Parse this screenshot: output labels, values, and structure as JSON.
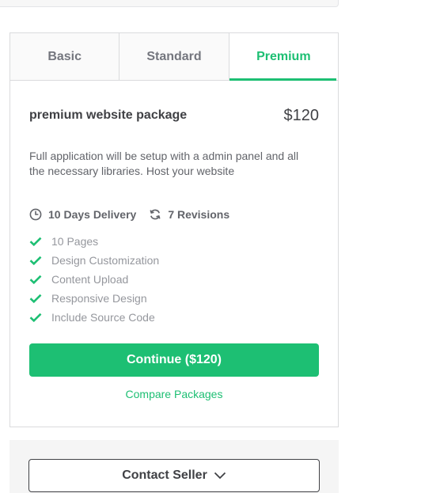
{
  "tabs": [
    {
      "label": "Basic",
      "active": false
    },
    {
      "label": "Standard",
      "active": false
    },
    {
      "label": "Premium",
      "active": true
    }
  ],
  "package": {
    "title": "premium website package",
    "price": "$120",
    "description": "Full application will be setup with a admin panel and all the necessary libraries. Host your website",
    "delivery": "10 Days Delivery",
    "delivery_icon": "clock-icon",
    "revisions": "7 Revisions",
    "revisions_icon": "refresh-icon",
    "features": [
      "10 Pages",
      "Design Customization",
      "Content Upload",
      "Responsive Design",
      "Include Source Code"
    ],
    "feature_icon": "check-icon"
  },
  "actions": {
    "continue_label": "Continue ($120)",
    "compare_label": "Compare Packages",
    "contact_label": "Contact Seller",
    "contact_icon": "chevron-down-icon"
  },
  "colors": {
    "accent": "#1dbf73",
    "text": "#404145",
    "muted": "#95979d"
  }
}
